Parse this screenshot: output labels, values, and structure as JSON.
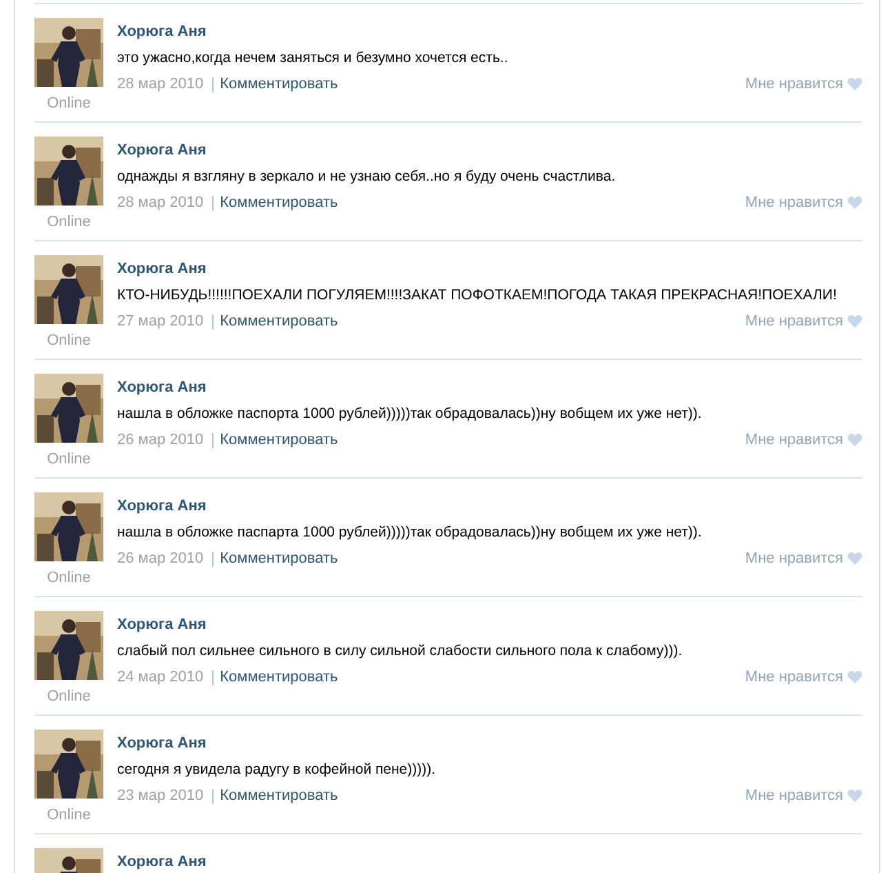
{
  "wall": {
    "posts": [
      {
        "author": "Хорюга Аня",
        "status": "Online",
        "text": "это ужасно,когда нечем заняться и безумно хочется есть..",
        "date": "28 мар 2010",
        "comment_link": "Комментировать",
        "like_label": "Мне нравится"
      },
      {
        "author": "Хорюга Аня",
        "status": "Online",
        "text": "однажды я взгляну в зеркало и не узнаю себя..но я буду очень счастлива.",
        "date": "28 мар 2010",
        "comment_link": "Комментировать",
        "like_label": "Мне нравится"
      },
      {
        "author": "Хорюга Аня",
        "status": "Online",
        "text": "КТО-НИБУДЬ!!!!!!ПОЕХАЛИ ПОГУЛЯЕМ!!!!ЗАКАТ ПОФОТКАЕМ!ПОГОДА ТАКАЯ ПРЕКРАСНАЯ!ПОЕХАЛИ!",
        "date": "27 мар 2010",
        "comment_link": "Комментировать",
        "like_label": "Мне нравится"
      },
      {
        "author": "Хорюга Аня",
        "status": "Online",
        "text": "нашла в обложке паспорта 1000 рублей)))))так обрадовалась))ну вобщем их уже нет)).",
        "date": "26 мар 2010",
        "comment_link": "Комментировать",
        "like_label": "Мне нравится"
      },
      {
        "author": "Хорюга Аня",
        "status": "Online",
        "text": "нашла в обложке паспарта 1000 рублей)))))так обрадовалась))ну вобщем их уже нет)).",
        "date": "26 мар 2010",
        "comment_link": "Комментировать",
        "like_label": "Мне нравится"
      },
      {
        "author": "Хорюга Аня",
        "status": "Online",
        "text": "слабый пол сильнее сильного в силу сильной слабости сильного пола к слабому))).",
        "date": "24 мар 2010",
        "comment_link": "Комментировать",
        "like_label": "Мне нравится"
      },
      {
        "author": "Хорюга Аня",
        "status": "Online",
        "text": "сегодня я увидела радугу в кофейной пене))))).",
        "date": "23 мар 2010",
        "comment_link": "Комментировать",
        "like_label": "Мне нравится"
      },
      {
        "author": "Хорюга Аня"
      }
    ]
  }
}
